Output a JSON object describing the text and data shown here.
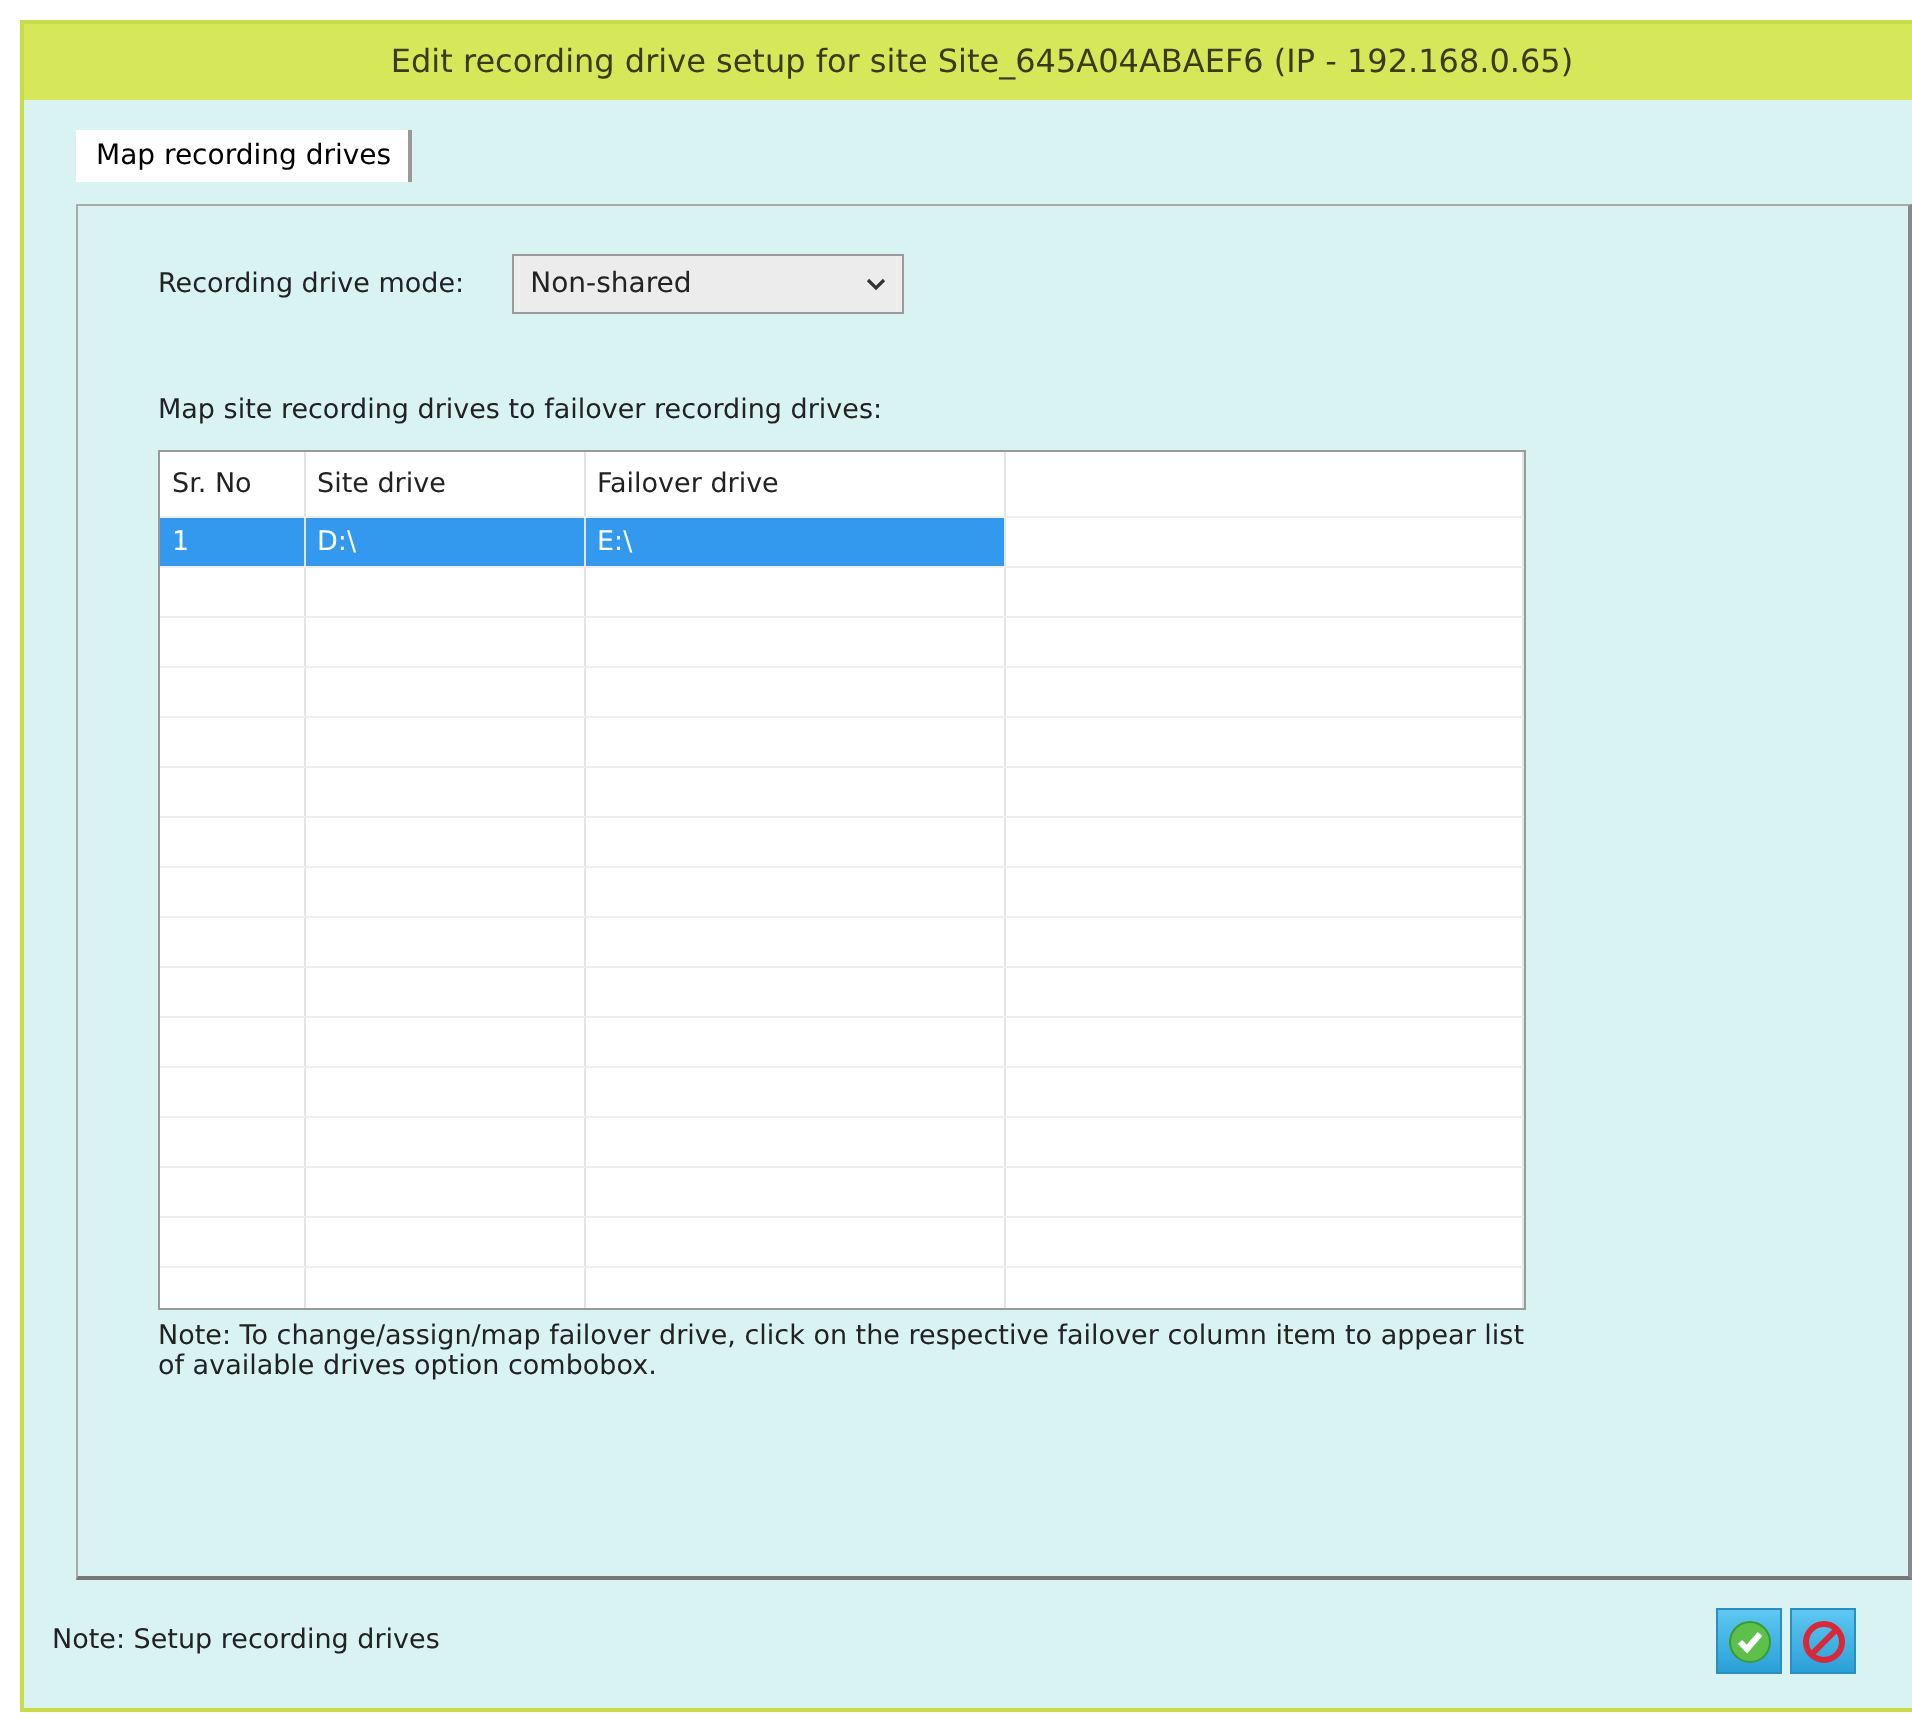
{
  "window": {
    "title": "Edit recording drive setup for site Site_645A04ABAEF6 (IP - 192.168.0.65)"
  },
  "tabs": [
    {
      "label": "Map recording drives",
      "selected": true
    }
  ],
  "mode": {
    "label": "Recording drive mode:",
    "value": "Non-shared"
  },
  "table": {
    "caption": "Map site recording drives to failover recording drives:",
    "columns": [
      "Sr. No",
      "Site drive",
      "Failover drive"
    ],
    "rows": [
      {
        "cells": [
          "1",
          "D:\\",
          "E:\\"
        ],
        "selected": true
      }
    ]
  },
  "table_note": "Note: To change/assign/map failover drive, click on the respective failover column item to appear list of available drives option combobox.",
  "status_note": "Note: Setup recording drives",
  "buttons": [
    {
      "kind": "ok"
    },
    {
      "kind": "cancel"
    }
  ]
}
